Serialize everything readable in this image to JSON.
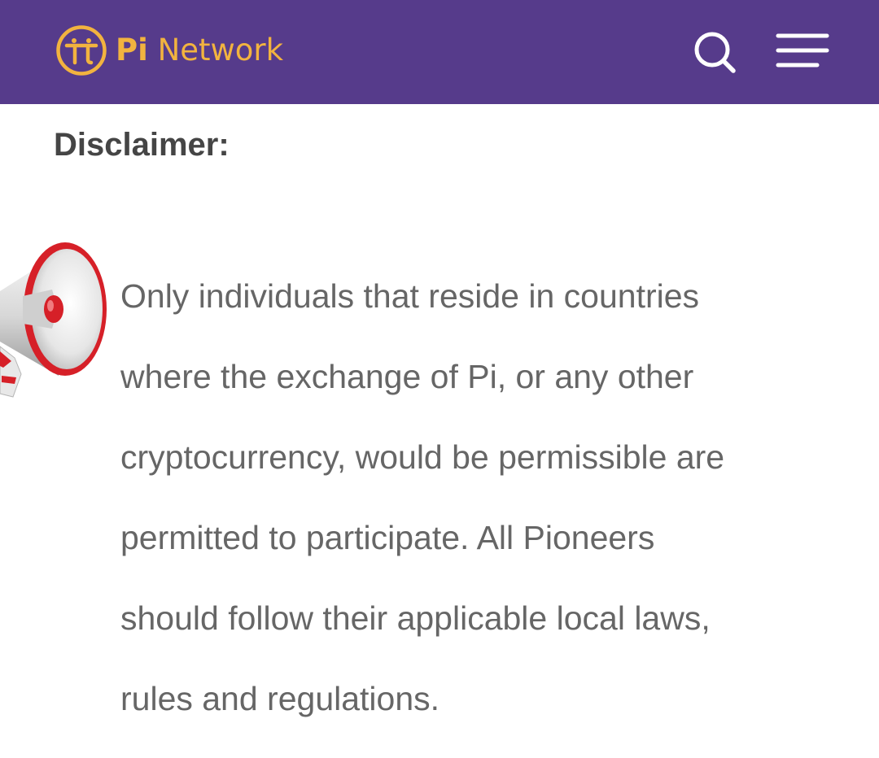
{
  "header": {
    "brand_bold": "Pi",
    "brand_rest": " Network",
    "logo_icon": "pi-symbol-icon",
    "search_icon": "search-icon",
    "menu_icon": "hamburger-menu-icon",
    "background_color": "#563b8b",
    "brand_color": "#f2b33f"
  },
  "main": {
    "heading": "Disclaimer:",
    "illustration_icon": "megaphone-icon",
    "lines": [
      "Only individuals that reside in countries",
      "where the exchange of Pi, or any other",
      "cryptocurrency, would be permissible are",
      "permitted to participate. All Pioneers",
      "should follow their applicable local laws,",
      "rules and regulations."
    ]
  }
}
